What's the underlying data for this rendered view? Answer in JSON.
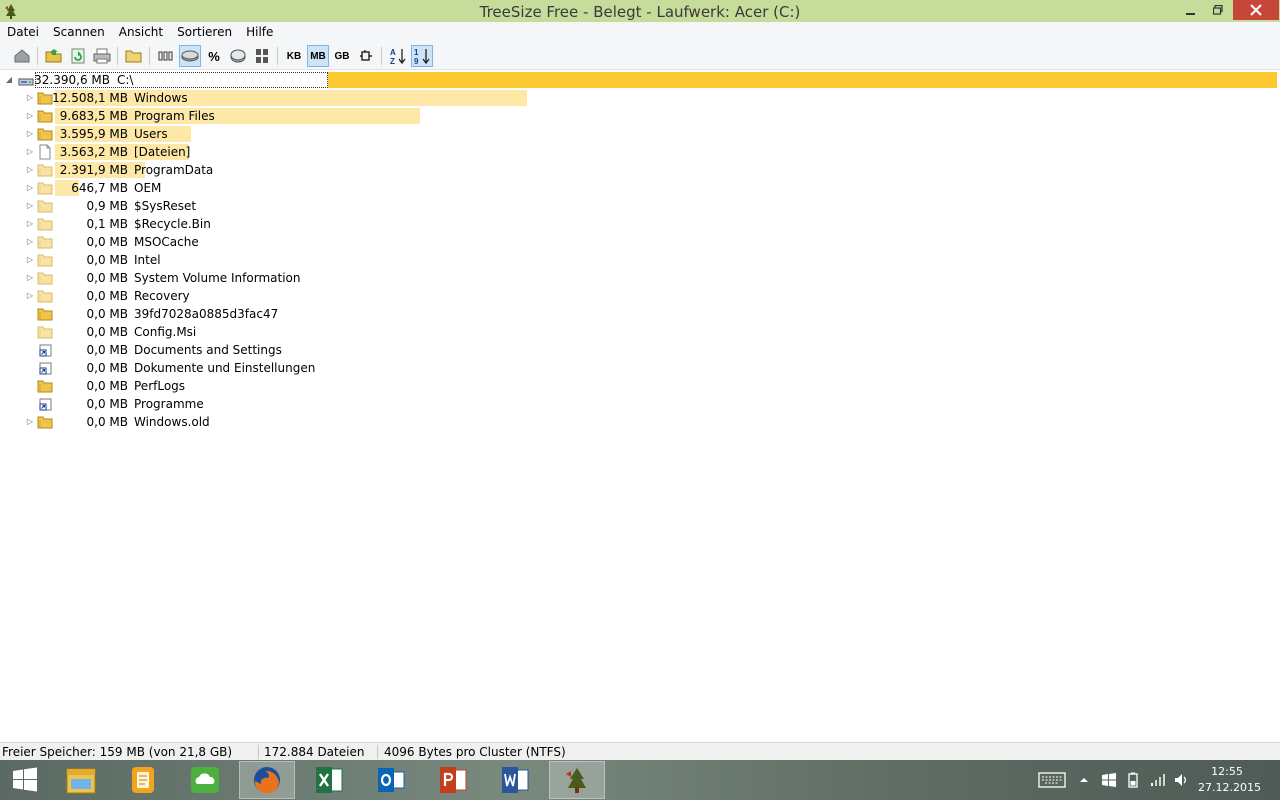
{
  "window": {
    "title": "TreeSize Free - Belegt - Laufwerk: Acer (C:)",
    "accent_color": "#c5dc9a",
    "close_color": "#c7463a"
  },
  "menu": [
    "Datei",
    "Scannen",
    "Ansicht",
    "Sortieren",
    "Hilfe"
  ],
  "toolbar": {
    "unit_kb": "KB",
    "unit_mb": "MB",
    "unit_gb": "GB",
    "percent": "%",
    "selected_unit": "MB",
    "icons": [
      "drive-icon",
      "open-folder-icon",
      "refresh-icon",
      "print-icon",
      "folder-browse-icon",
      "size-bars-icon",
      "disk-size-icon",
      "percent-icon",
      "allocated-space-icon",
      "file-count-icon",
      "unit-kb",
      "unit-mb",
      "unit-gb",
      "auto-unit-icon",
      "sort-name-icon",
      "sort-size-icon"
    ]
  },
  "tree": {
    "root": {
      "size": "32.390,6 MB",
      "name": "C:\\",
      "fill": 1.0
    },
    "items": [
      {
        "size": "12.508,1 MB",
        "name": "Windows",
        "icon": "folder",
        "expandable": true,
        "fill": 0.386
      },
      {
        "size": "9.683,5 MB",
        "name": "Program Files",
        "icon": "folder",
        "expandable": true,
        "fill": 0.299
      },
      {
        "size": "3.595,9 MB",
        "name": "Users",
        "icon": "folder",
        "expandable": true,
        "fill": 0.111
      },
      {
        "size": "3.563,2 MB",
        "name": "[Dateien]",
        "icon": "file",
        "expandable": true,
        "fill": 0.11
      },
      {
        "size": "2.391,9 MB",
        "name": "ProgramData",
        "icon": "folder-light",
        "expandable": true,
        "fill": 0.074
      },
      {
        "size": "646,7 MB",
        "name": "OEM",
        "icon": "folder-light",
        "expandable": true,
        "fill": 0.02
      },
      {
        "size": "0,9 MB",
        "name": "$SysReset",
        "icon": "folder-light",
        "expandable": true,
        "fill": 0
      },
      {
        "size": "0,1 MB",
        "name": "$Recycle.Bin",
        "icon": "folder-light",
        "expandable": true,
        "fill": 0
      },
      {
        "size": "0,0 MB",
        "name": "MSOCache",
        "icon": "folder-light",
        "expandable": true,
        "fill": 0
      },
      {
        "size": "0,0 MB",
        "name": "Intel",
        "icon": "folder-light",
        "expandable": true,
        "fill": 0
      },
      {
        "size": "0,0 MB",
        "name": "System Volume Information",
        "icon": "folder-light",
        "expandable": true,
        "fill": 0
      },
      {
        "size": "0,0 MB",
        "name": "Recovery",
        "icon": "folder-light",
        "expandable": true,
        "fill": 0
      },
      {
        "size": "0,0 MB",
        "name": "39fd7028a0885d3fac47",
        "icon": "folder",
        "expandable": false,
        "fill": 0
      },
      {
        "size": "0,0 MB",
        "name": "Config.Msi",
        "icon": "folder-light",
        "expandable": false,
        "fill": 0
      },
      {
        "size": "0,0 MB",
        "name": "Documents and Settings",
        "icon": "shortcut",
        "expandable": false,
        "fill": 0
      },
      {
        "size": "0,0 MB",
        "name": "Dokumente und Einstellungen",
        "icon": "shortcut",
        "expandable": false,
        "fill": 0
      },
      {
        "size": "0,0 MB",
        "name": "PerfLogs",
        "icon": "folder",
        "expandable": false,
        "fill": 0
      },
      {
        "size": "0,0 MB",
        "name": "Programme",
        "icon": "shortcut",
        "expandable": false,
        "fill": 0
      },
      {
        "size": "0,0 MB",
        "name": "Windows.old",
        "icon": "folder",
        "expandable": true,
        "fill": 0
      }
    ]
  },
  "status": {
    "free_space": "Freier Speicher: 159 MB  (von 21,8 GB)",
    "file_count": "172.884  Dateien",
    "cluster": "4096 Bytes pro Cluster (NTFS)"
  },
  "taskbar": {
    "apps": [
      "start-icon",
      "explorer-icon",
      "notes-app-icon",
      "cloud-app-icon",
      "firefox-icon",
      "excel-icon",
      "outlook-icon",
      "powerpoint-icon",
      "word-icon",
      "treesize-icon"
    ],
    "active_app": "treesize-icon",
    "time": "12:55",
    "date": "27.12.2015"
  }
}
